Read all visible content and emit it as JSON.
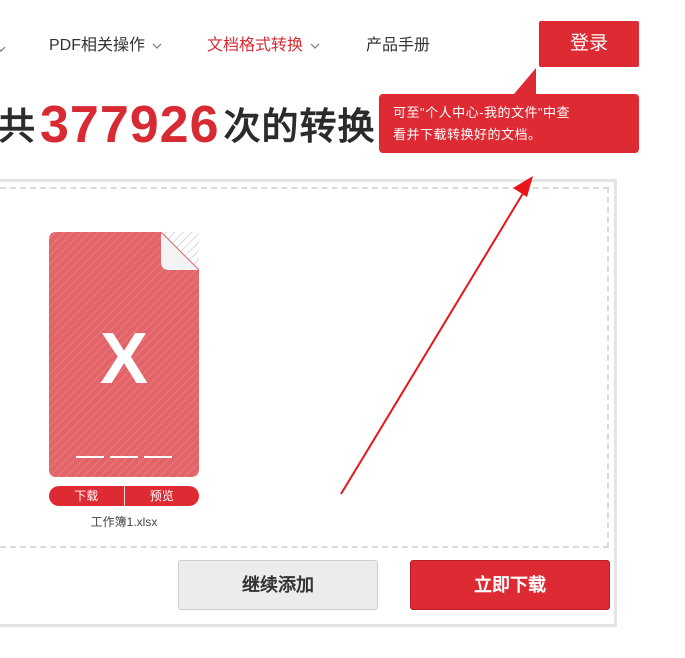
{
  "nav": {
    "items": [
      {
        "label": "PDF相关操作",
        "active": false
      },
      {
        "label": "文档格式转换",
        "active": true
      },
      {
        "label": "产品手册",
        "active": false
      }
    ],
    "login_label": "登录"
  },
  "tooltip": {
    "line1": "可至\"个人中心-我的文件\"中查",
    "line2": "看并下载转换好的文档。"
  },
  "headline": {
    "prefix": "共",
    "count": "377926",
    "suffix": "次的转换"
  },
  "file": {
    "name": "工作簿1.xlsx",
    "type_letter": "X",
    "download_label": "下载",
    "preview_label": "预览"
  },
  "actions": {
    "continue_label": "继续添加",
    "download_now_label": "立即下载"
  },
  "colors": {
    "accent": "#de2a33",
    "file_icon": "#e26468"
  }
}
